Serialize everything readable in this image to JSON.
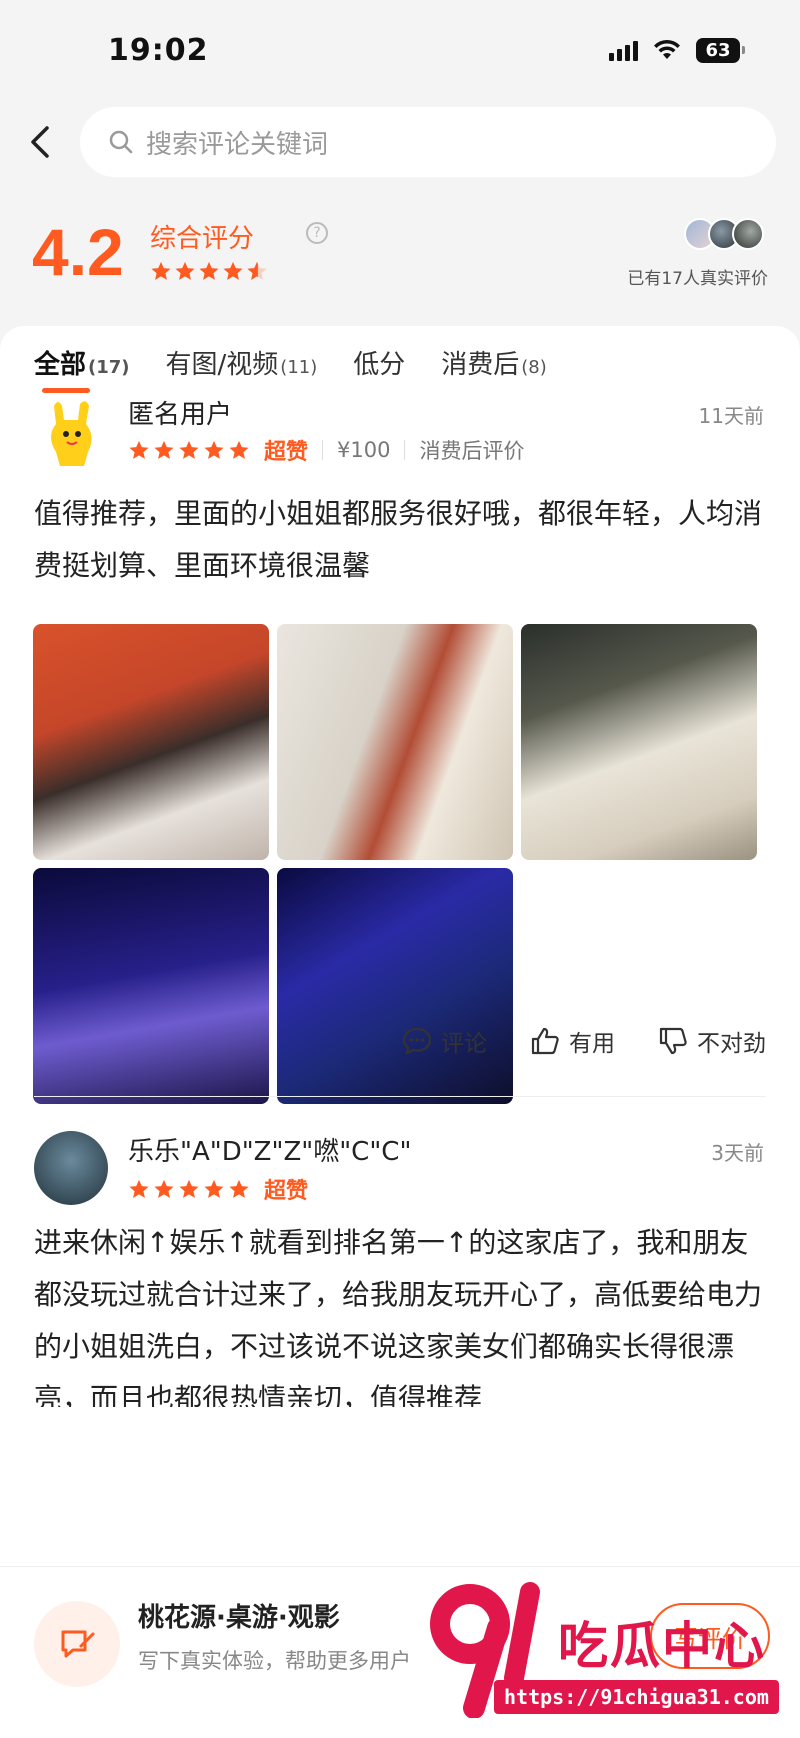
{
  "status": {
    "time": "19:02",
    "battery": "63"
  },
  "search": {
    "placeholder": "搜索评论关键词"
  },
  "rating": {
    "score": "4.2",
    "label": "综合评分",
    "stars": 4.5,
    "count_text": "已有17人真实评价"
  },
  "tabs": [
    {
      "label": "全部",
      "count": "(17)",
      "active": true
    },
    {
      "label": "有图/视频",
      "count": "(11)",
      "active": false
    },
    {
      "label": "低分",
      "count": "",
      "active": false
    },
    {
      "label": "消费后",
      "count": "(8)",
      "active": false
    }
  ],
  "reviews": [
    {
      "user": "匿名用户",
      "time": "11天前",
      "stars": 5,
      "praise": "超赞",
      "price": "¥100",
      "tag": "消费后评价",
      "text": "值得推荐，里面的小姐姐都服务很好哦，都很年轻，人均消费挺划算、里面环境很温馨",
      "photos": 5
    },
    {
      "user": "乐乐\"A\"D\"Z\"Z\"嘫\"C\"C\"",
      "time": "3天前",
      "stars": 5,
      "praise": "超赞",
      "text": "进来休闲↑娱乐↑就看到排名第一↑的这家店了，我和朋友都没玩过就合计过来了，给我朋友玩开心了，高低要给电力的小姐姐洗白，不过该说不说这家美女们都确实长得很漂亮，而且也都很热情亲切，值得推荐"
    }
  ],
  "actions": {
    "comment": "评论",
    "useful": "有用",
    "wrong": "不对劲"
  },
  "bottom": {
    "title": "桃花源·桌游·观影",
    "subtitle": "写下真实体验，帮助更多用户",
    "button": "写评价"
  },
  "watermark": {
    "logo": "91吃瓜中心",
    "url": "https://91chigua31.com"
  },
  "colors": {
    "accent": "#ff5a1f",
    "watermark": "#e1174c"
  }
}
